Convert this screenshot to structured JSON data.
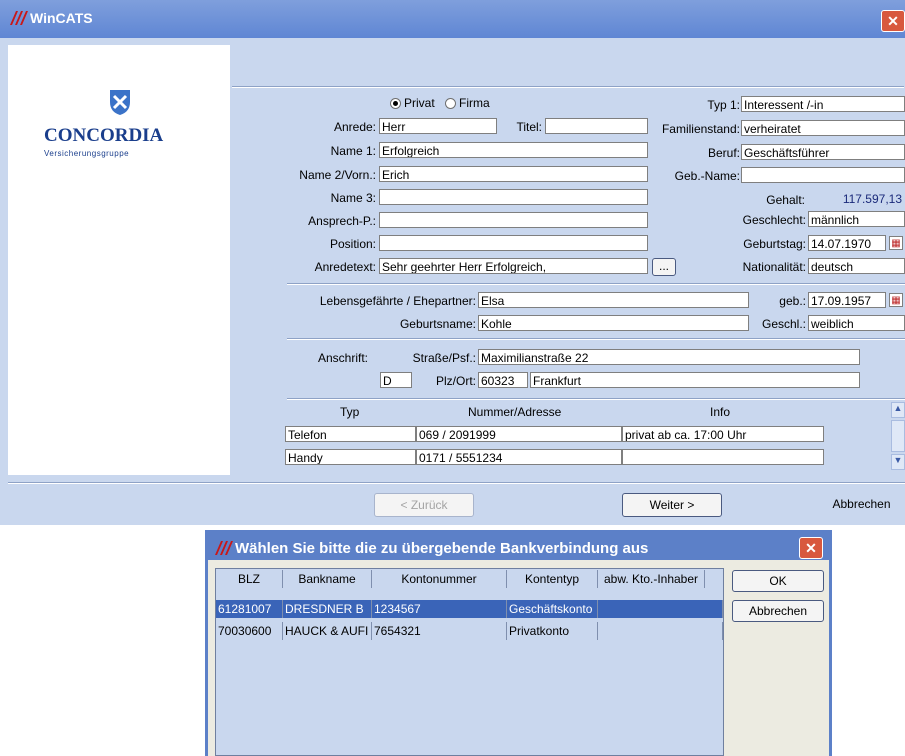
{
  "window": {
    "title": "WinCATS",
    "close": "✕"
  },
  "logo": {
    "name": "CONCORDIA",
    "subtitle": "Versicherungsgruppe"
  },
  "form": {
    "radio_privat": "Privat",
    "radio_firma": "Firma",
    "anrede_label": "Anrede:",
    "anrede_value": "Herr",
    "titel_label": "Titel:",
    "titel_value": "",
    "name1_label": "Name 1:",
    "name1_value": "Erfolgreich",
    "name2_label": "Name 2/Vorn.:",
    "name2_value": "Erich",
    "name3_label": "Name 3:",
    "name3_value": "",
    "ansprech_label": "Ansprech-P.:",
    "ansprech_value": "",
    "position_label": "Position:",
    "position_value": "",
    "anredetext_label": "Anredetext:",
    "anredetext_value": "Sehr geehrter Herr Erfolgreich,",
    "ellipsis": "...",
    "typ1_label": "Typ 1:",
    "typ1_value": "Interessent /-in",
    "familienstand_label": "Familienstand:",
    "familienstand_value": "verheiratet",
    "beruf_label": "Beruf:",
    "beruf_value": "Geschäftsführer",
    "gebname_label": "Geb.-Name:",
    "gebname_value": "",
    "gehalt_label": "Gehalt:",
    "gehalt_value": "117.597,13",
    "geschlecht_label": "Geschlecht:",
    "geschlecht_value": "männlich",
    "geburtstag_label": "Geburtstag:",
    "geburtstag_value": "14.07.1970",
    "nationalitaet_label": "Nationalität:",
    "nationalitaet_value": "deutsch"
  },
  "partner": {
    "label": "Lebensgefährte / Ehepartner:",
    "value": "Elsa",
    "geb_label": "geb.:",
    "geb_value": "17.09.1957",
    "geburtsname_label": "Geburtsname:",
    "geburtsname_value": "Kohle",
    "geschl_label": "Geschl.:",
    "geschl_value": "weiblich"
  },
  "address": {
    "anschrift_label": "Anschrift:",
    "strasse_label": "Straße/Psf.:",
    "strasse_value": "Maximilianstraße 22",
    "land_value": "D",
    "plzort_label": "Plz/Ort:",
    "plz_value": "60323",
    "ort_value": "Frankfurt"
  },
  "contacts": {
    "headers": [
      "Typ",
      "Nummer/Adresse",
      "Info"
    ],
    "rows": [
      {
        "typ": "Telefon",
        "nummer": "069 / 2091999",
        "info": "privat ab ca. 17:00 Uhr"
      },
      {
        "typ": "Handy",
        "nummer": "0171 / 5551234",
        "info": ""
      }
    ]
  },
  "buttons": {
    "back": "< Zurück",
    "next": "Weiter >",
    "cancel": "Abbrechen"
  },
  "dialog": {
    "title": "Wählen Sie bitte die zu übergebende Bankverbindung aus",
    "ok": "OK",
    "cancel": "Abbrechen",
    "headers": [
      "BLZ",
      "Bankname",
      "Kontonummer",
      "Kontentyp",
      "abw. Kto.-Inhaber"
    ],
    "rows": [
      {
        "blz": "61281007",
        "bank": "DRESDNER B",
        "konto": "1234567",
        "typ": "Geschäftskonto",
        "inhaber": ""
      },
      {
        "blz": "70030600",
        "bank": "HAUCK & AUFI",
        "konto": "7654321",
        "typ": "Privatkonto",
        "inhaber": ""
      }
    ]
  },
  "colors": {
    "window_bg": "#c9d7ee",
    "titlebar": "#6a8fd8",
    "close": "#d8583e",
    "selected_row": "#3a64b8"
  },
  "icons": {
    "close": "close-icon",
    "calendar": "calendar-icon",
    "scroll_up": "scroll-up-icon",
    "scroll_down": "scroll-down-icon"
  }
}
